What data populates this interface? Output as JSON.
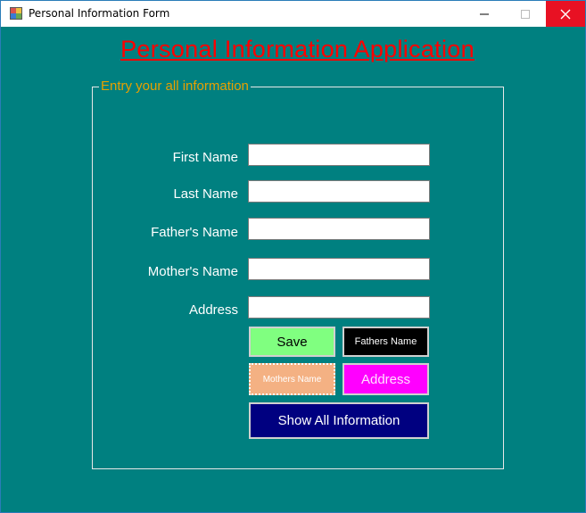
{
  "window": {
    "title": "Personal Information Form",
    "controls": {
      "minimize_icon": "minimize-icon",
      "maximize_icon": "maximize-icon",
      "close_icon": "close-icon"
    }
  },
  "form": {
    "heading": "Personal Information Application",
    "group_title": "Entry your all information",
    "fields": [
      {
        "label": "First Name",
        "value": ""
      },
      {
        "label": "Last Name",
        "value": ""
      },
      {
        "label": "Father's Name",
        "value": ""
      },
      {
        "label": "Mother's Name",
        "value": ""
      },
      {
        "label": "Address",
        "value": ""
      }
    ],
    "buttons": {
      "save": "Save",
      "fathers_name": "Fathers Name",
      "mothers_name": "Mothers Name",
      "address": "Address",
      "show_all": "Show All Information"
    }
  },
  "colors": {
    "background": "#008080",
    "heading": "#ff0000",
    "group_title": "#e8a000",
    "save_button": "#80ff80",
    "fathers_button": "#000000",
    "mothers_button": "#f4b183",
    "address_button": "#ff00ff",
    "show_all_button": "#000080",
    "close_button": "#e81123"
  }
}
